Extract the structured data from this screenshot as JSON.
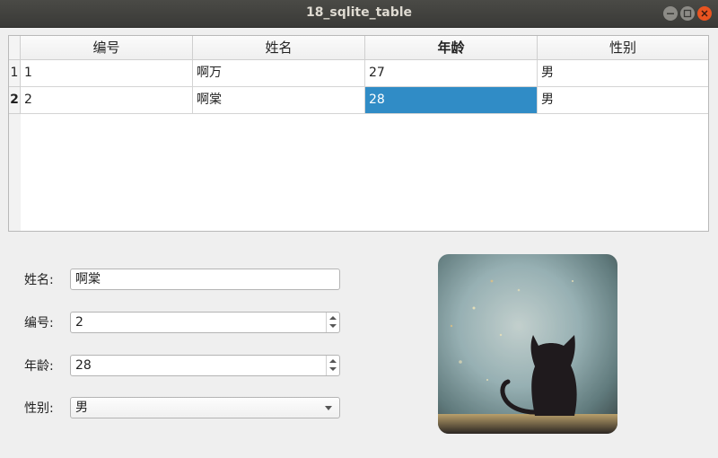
{
  "window": {
    "title": "18_sqlite_table"
  },
  "table": {
    "headers": [
      "编号",
      "姓名",
      "年龄",
      "性别"
    ],
    "row_headers": [
      "1",
      "2"
    ],
    "rows": [
      [
        "1",
        "啊万",
        "27",
        "男"
      ],
      [
        "2",
        "啊棠",
        "28",
        "男"
      ]
    ]
  },
  "form": {
    "name_label": "姓名:",
    "name_value": "啊棠",
    "id_label": "编号:",
    "id_value": "2",
    "age_label": "年龄:",
    "age_value": "28",
    "gender_label": "性别:",
    "gender_value": "男"
  },
  "colors": {
    "selection": "#308cc6",
    "close_button": "#e95420"
  },
  "image": {
    "subject": "cat-silhouette-window"
  }
}
